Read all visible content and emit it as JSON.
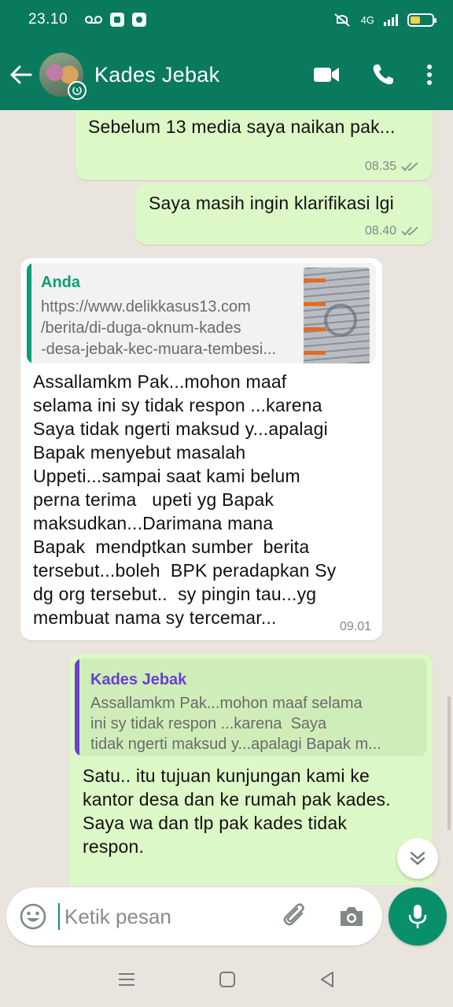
{
  "status_bar": {
    "time": "23.10",
    "network": "4G",
    "battery_level": 0.45
  },
  "header": {
    "contact_name": "Kades Jebak"
  },
  "messages": [
    {
      "direction": "out",
      "text": "Sebelum 13 media saya naikan pak...",
      "time": "08.35"
    },
    {
      "direction": "out",
      "text": "Saya masih ingin klarifikasi lgi",
      "time": "08.40"
    },
    {
      "direction": "in",
      "quote": {
        "author": "Anda",
        "lines": [
          "https://www.delikkasus13.com",
          "/berita/di-duga-oknum-kades",
          "-desa-jebak-kec-muara-tembesi..."
        ]
      },
      "lines": [
        "Assallamkm Pak...mohon maaf",
        "selama ini sy tidak respon ...karena",
        "Saya tidak ngerti maksud y...apalagi",
        "Bapak menyebut masalah",
        "Uppeti...sampai saat kami belum",
        "perna terima   upeti yg Bapak",
        "maksudkan...Darimana mana",
        "Bapak  mendptkan sumber  berita",
        "tersebut...boleh  BPK peradapkan Sy",
        "dg org tersebut..  sy pingin tau...yg",
        "membuat nama sy tercemar..."
      ],
      "time": "09.01"
    },
    {
      "direction": "out",
      "quote": {
        "author": "Kades Jebak",
        "lines": [
          "Assallamkm Pak...mohon maaf selama",
          "ini sy tidak respon ...karena  Saya",
          "tidak ngerti maksud y...apalagi Bapak m..."
        ]
      },
      "lines": [
        "Satu.. itu tujuan kunjungan kami ke",
        "kantor desa dan ke rumah pak kades.",
        "Saya wa dan tlp pak kades tidak",
        "respon."
      ]
    }
  ],
  "composer": {
    "placeholder": "Ketik pesan"
  },
  "colors": {
    "header": "#0a7a5f",
    "outgoing_bubble": "#dcf8c6",
    "incoming_bubble": "#ffffff",
    "quote_self": "#0a9e76",
    "quote_contact": "#6a3fd2"
  }
}
